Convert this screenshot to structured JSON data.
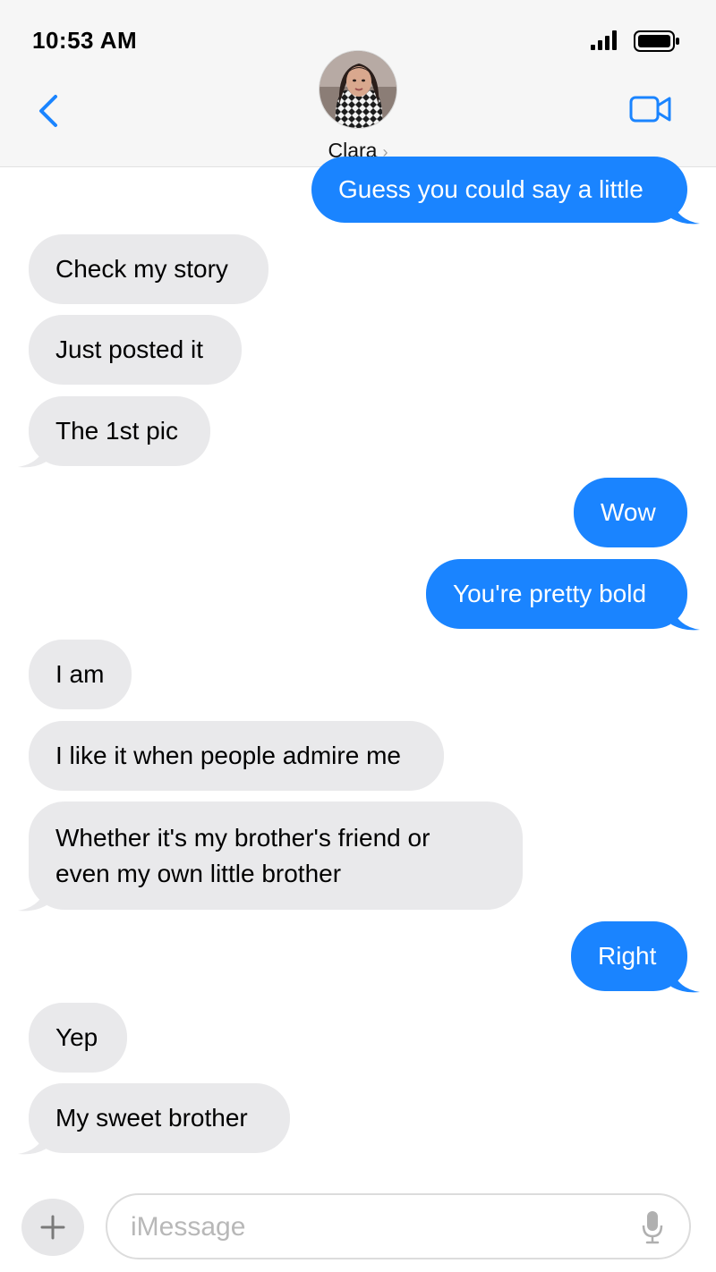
{
  "status": {
    "time": "10:53 AM"
  },
  "contact": {
    "name": "Clara",
    "chevron": "›"
  },
  "messages": [
    {
      "from": "me",
      "text": "Guess you could say a little"
    },
    {
      "from": "them",
      "text": "Check my story"
    },
    {
      "from": "them",
      "text": "Just posted it"
    },
    {
      "from": "them",
      "text": "The 1st pic"
    },
    {
      "from": "me",
      "text": "Wow"
    },
    {
      "from": "me",
      "text": "You're pretty bold"
    },
    {
      "from": "them",
      "text": "I am"
    },
    {
      "from": "them",
      "text": "I like it when people admire me"
    },
    {
      "from": "them",
      "text": "Whether it's my brother's friend or even my own little brother"
    },
    {
      "from": "me",
      "text": "Right"
    },
    {
      "from": "them",
      "text": "Yep"
    },
    {
      "from": "them",
      "text": "My sweet brother"
    }
  ],
  "composer": {
    "placeholder": "iMessage",
    "value": ""
  },
  "colors": {
    "accent": "#1a84ff",
    "incoming": "#e9e9eb",
    "header": "#f6f6f6"
  },
  "icons": [
    "signal-icon",
    "battery-icon",
    "back-chevron-icon",
    "video-camera-icon",
    "plus-icon",
    "microphone-icon"
  ]
}
